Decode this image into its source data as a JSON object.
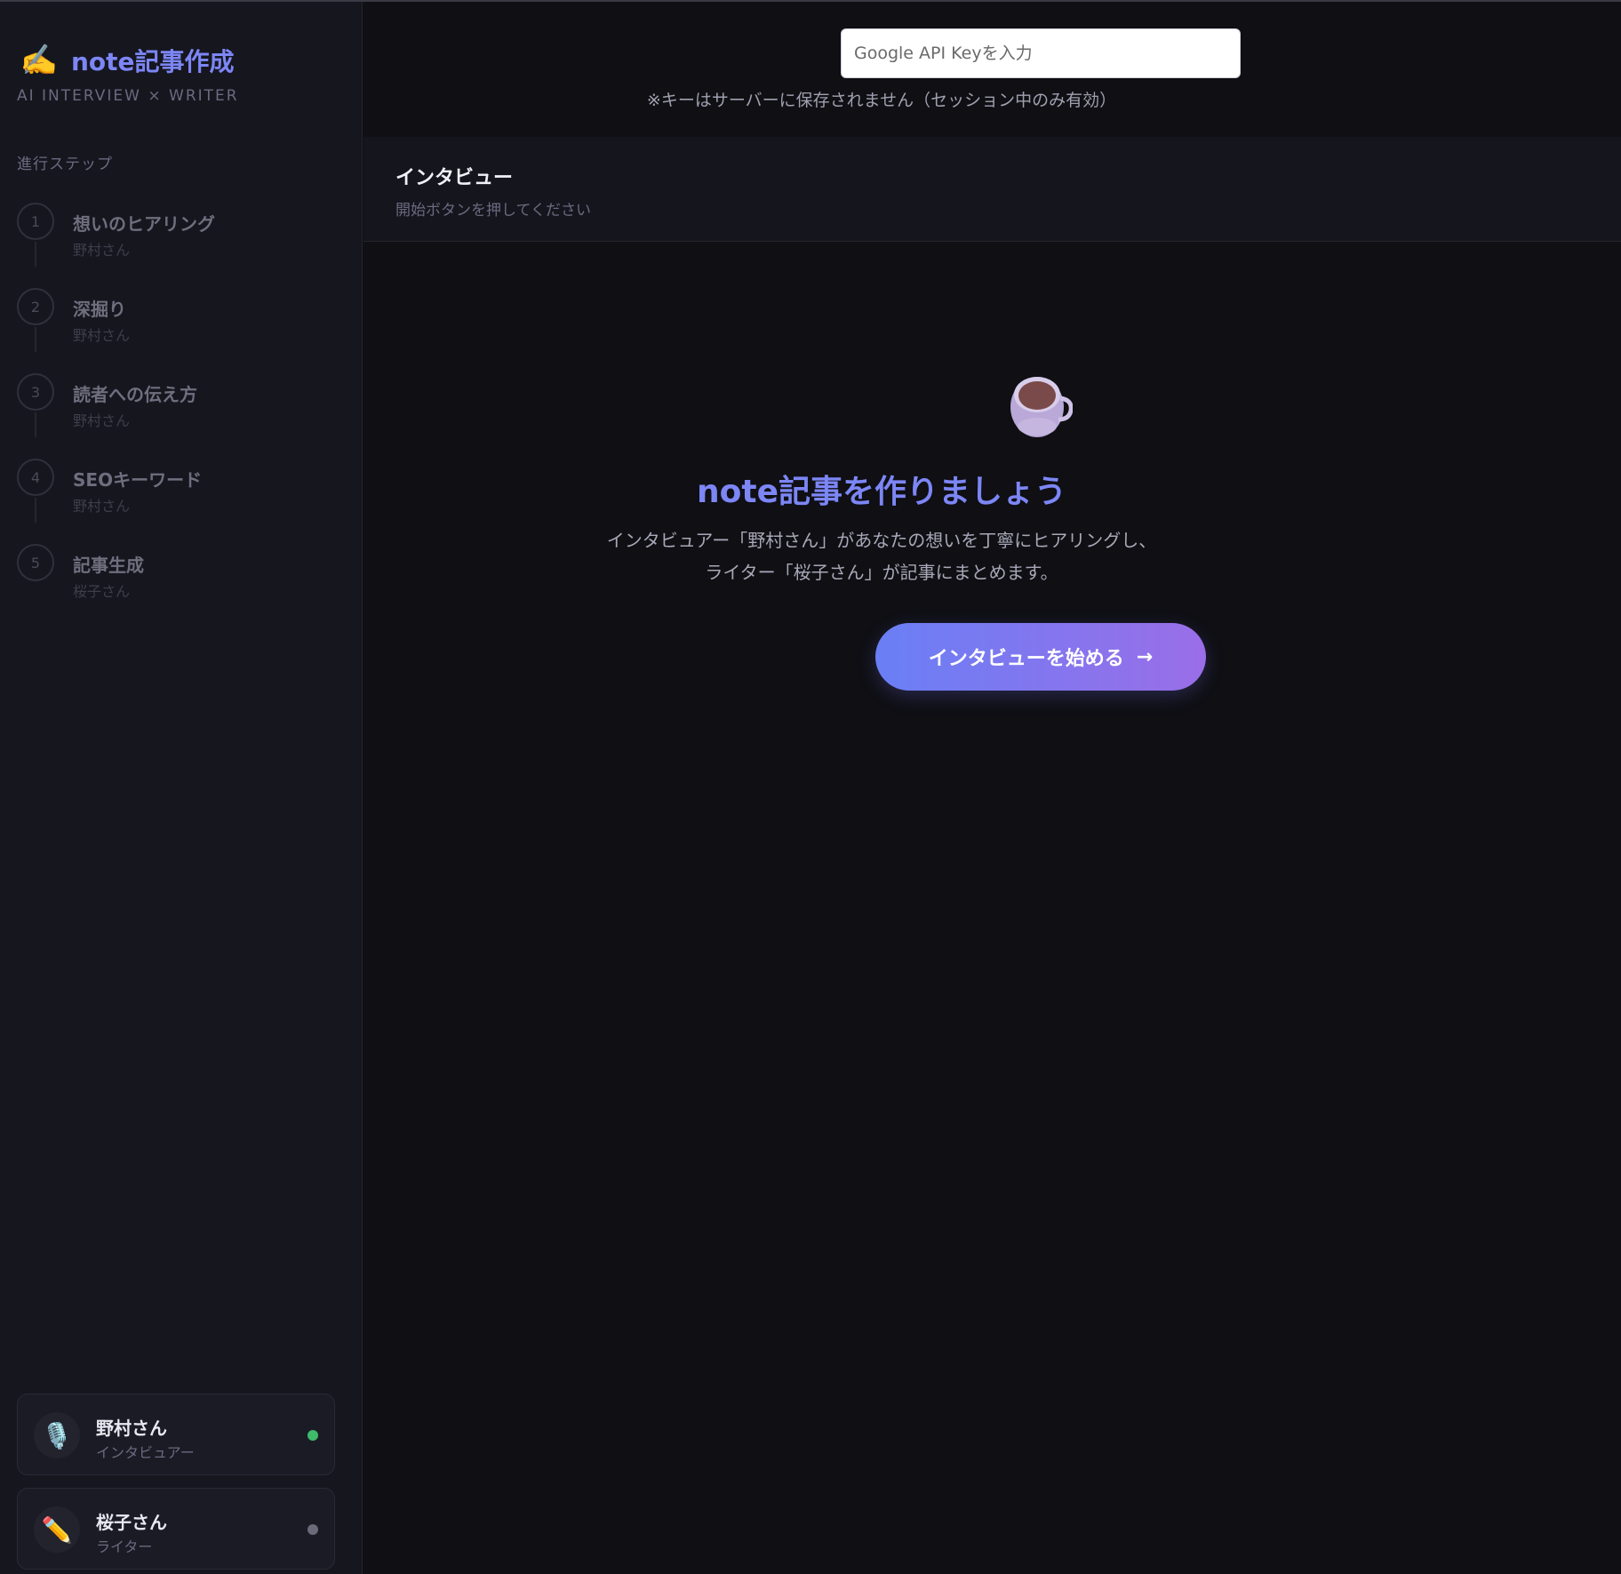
{
  "brand": {
    "icon": "✍️",
    "title": "note記事作成",
    "subtitle": "AI INTERVIEW × WRITER"
  },
  "sidebar": {
    "section_label": "進行ステップ",
    "steps": [
      {
        "num": "1",
        "title": "想いのヒアリング",
        "agent": "野村さん"
      },
      {
        "num": "2",
        "title": "深掘り",
        "agent": "野村さん"
      },
      {
        "num": "3",
        "title": "読者への伝え方",
        "agent": "野村さん"
      },
      {
        "num": "4",
        "title": "SEOキーワード",
        "agent": "野村さん"
      },
      {
        "num": "5",
        "title": "記事生成",
        "agent": "桜子さん"
      }
    ],
    "agents": [
      {
        "icon": "🎙️",
        "name": "野村さん",
        "role": "インタビュアー",
        "status_color": "#3fb96a"
      },
      {
        "icon": "✏️",
        "name": "桜子さん",
        "role": "ライター",
        "status_color": "#6a6a78"
      }
    ]
  },
  "topbar": {
    "api_placeholder": "Google API Keyを入力",
    "api_note": "※キーはサーバーに保存されません（セッション中のみ有効）"
  },
  "header": {
    "title": "インタビュー",
    "subtitle": "開始ボタンを押してください"
  },
  "hero": {
    "icon": "tea-cup-icon",
    "title": "note記事を作りましょう",
    "desc_line1": "インタビュアー「野村さん」があなたの想いを丁寧にヒアリングし、",
    "desc_line2": "ライター「桜子さん」が記事にまとめます。",
    "button_label": "インタビューを始める",
    "button_arrow": "→"
  },
  "colors": {
    "accent": "#7c86f5",
    "bg": "#0f0f14",
    "sidebar": "#16161f"
  }
}
